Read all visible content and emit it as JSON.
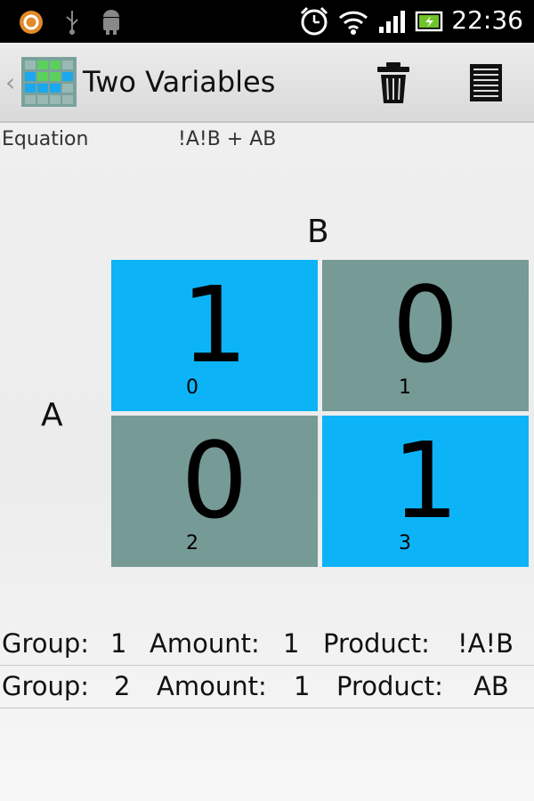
{
  "status_bar": {
    "time": "22:36",
    "icons": [
      "notification-circle-icon",
      "usb-icon",
      "android-debug-icon",
      "alarm-clock-icon",
      "wifi-icon",
      "signal-icon",
      "battery-icon"
    ]
  },
  "action_bar": {
    "title": "Two Variables",
    "up_glyph": "‹",
    "actions": [
      "trash-icon",
      "list-icon"
    ]
  },
  "equation": {
    "label": "Equation",
    "value": "!A!B + AB"
  },
  "kmap": {
    "col_var": "B",
    "row_var": "A",
    "on_color": "#0db3f7",
    "off_color": "#769a96",
    "cells": [
      {
        "value": "1",
        "index": "0",
        "state": "on"
      },
      {
        "value": "0",
        "index": "1",
        "state": "off"
      },
      {
        "value": "0",
        "index": "2",
        "state": "off"
      },
      {
        "value": "1",
        "index": "3",
        "state": "on"
      }
    ]
  },
  "groups": [
    {
      "group_label": "Group:",
      "group": "1",
      "amount_label": "Amount:",
      "amount": "1",
      "product_label": "Product:",
      "product": "!A!B"
    },
    {
      "group_label": "Group:",
      "group": "2",
      "amount_label": "Amount:",
      "amount": "1",
      "product_label": "Product:",
      "product": "AB"
    }
  ]
}
